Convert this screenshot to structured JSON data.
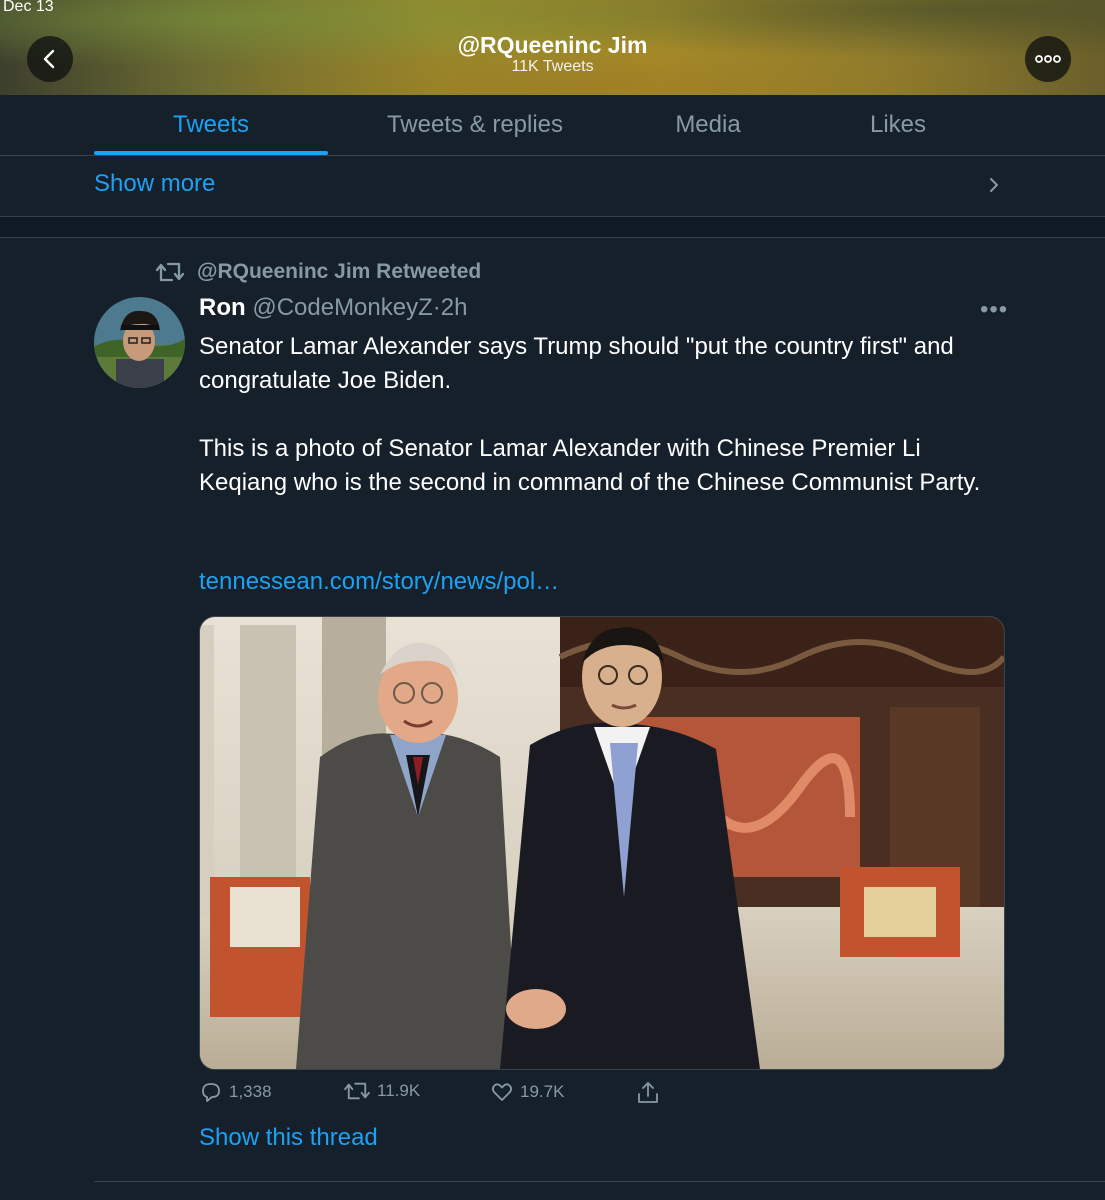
{
  "status": {
    "date": "Dec 13"
  },
  "header": {
    "title": "@RQueeninc Jim",
    "subtitle": "11K Tweets"
  },
  "tabs": [
    {
      "label": "Tweets",
      "active": true
    },
    {
      "label": "Tweets & replies",
      "active": false
    },
    {
      "label": "Media",
      "active": false
    },
    {
      "label": "Likes",
      "active": false
    }
  ],
  "show_more": {
    "label": "Show more"
  },
  "tweet": {
    "retweet_label": "@RQueeninc Jim Retweeted",
    "author_name": "Ron",
    "author_handle": "@CodeMonkeyZ",
    "separator": "·",
    "time": "2h",
    "paragraphs": [
      "Senator Lamar Alexander says Trump should \"put the country first\" and congratulate Joe Biden.",
      "This is a photo of Senator Lamar Alexander with Chinese Premier Li Keqiang who is the second in command of the Chinese Communist Party."
    ],
    "link": "tennessean.com/story/news/pol…",
    "counts": {
      "replies": "1,338",
      "retweets": "11.9K",
      "likes": "19.7K"
    },
    "show_thread": "Show this thread"
  },
  "colors": {
    "accent": "#1da1f2",
    "background": "#15202b",
    "secondary_text": "#8899a6",
    "divider": "#38444d"
  }
}
